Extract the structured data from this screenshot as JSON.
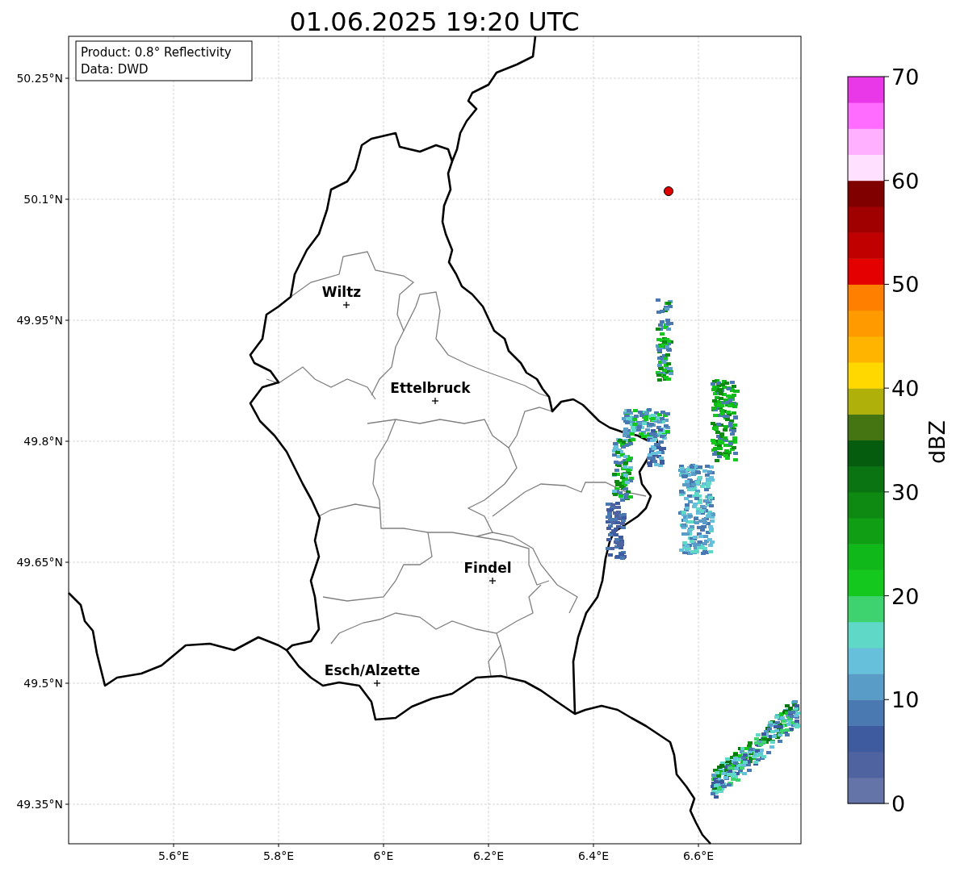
{
  "title": "01.06.2025 19:20 UTC",
  "info_box": {
    "lines": [
      "Product: 0.8° Reflectivity",
      "Data: DWD"
    ]
  },
  "map": {
    "x_ticks": [
      "5.6°E",
      "5.8°E",
      "6°E",
      "6.2°E",
      "6.4°E",
      "6.6°E"
    ],
    "y_ticks": [
      "50.25°N",
      "50.1°N",
      "49.95°N",
      "49.8°N",
      "49.65°N",
      "49.5°N",
      "49.35°N"
    ],
    "cities": [
      {
        "name": "Wiltz"
      },
      {
        "name": "Ettelbruck"
      },
      {
        "name": "Findel"
      },
      {
        "name": "Esch/Alzette"
      }
    ]
  },
  "colorbar": {
    "label": "dBZ",
    "ticks": [
      "70",
      "60",
      "50",
      "40",
      "30",
      "20",
      "10",
      "0"
    ],
    "bins": [
      {
        "color": "#6574a8"
      },
      {
        "color": "#4f63a0"
      },
      {
        "color": "#3f5ba0"
      },
      {
        "color": "#4a78b0"
      },
      {
        "color": "#5a9cc8"
      },
      {
        "color": "#66c0dc"
      },
      {
        "color": "#5fd8c8"
      },
      {
        "color": "#3ed36e"
      },
      {
        "color": "#14c81e"
      },
      {
        "color": "#10b81a"
      },
      {
        "color": "#109e14"
      },
      {
        "color": "#0e8a12"
      },
      {
        "color": "#0a7412"
      },
      {
        "color": "#065c0e"
      },
      {
        "color": "#457412"
      },
      {
        "color": "#b0b00a"
      },
      {
        "color": "#ffd800"
      },
      {
        "color": "#ffb400"
      },
      {
        "color": "#ff9a00"
      },
      {
        "color": "#ff7f00"
      },
      {
        "color": "#e40000"
      },
      {
        "color": "#c00000"
      },
      {
        "color": "#a00000"
      },
      {
        "color": "#800000"
      },
      {
        "color": "#ffe0ff"
      },
      {
        "color": "#ffb0ff"
      },
      {
        "color": "#ff6cff"
      },
      {
        "color": "#e838e8"
      }
    ]
  }
}
